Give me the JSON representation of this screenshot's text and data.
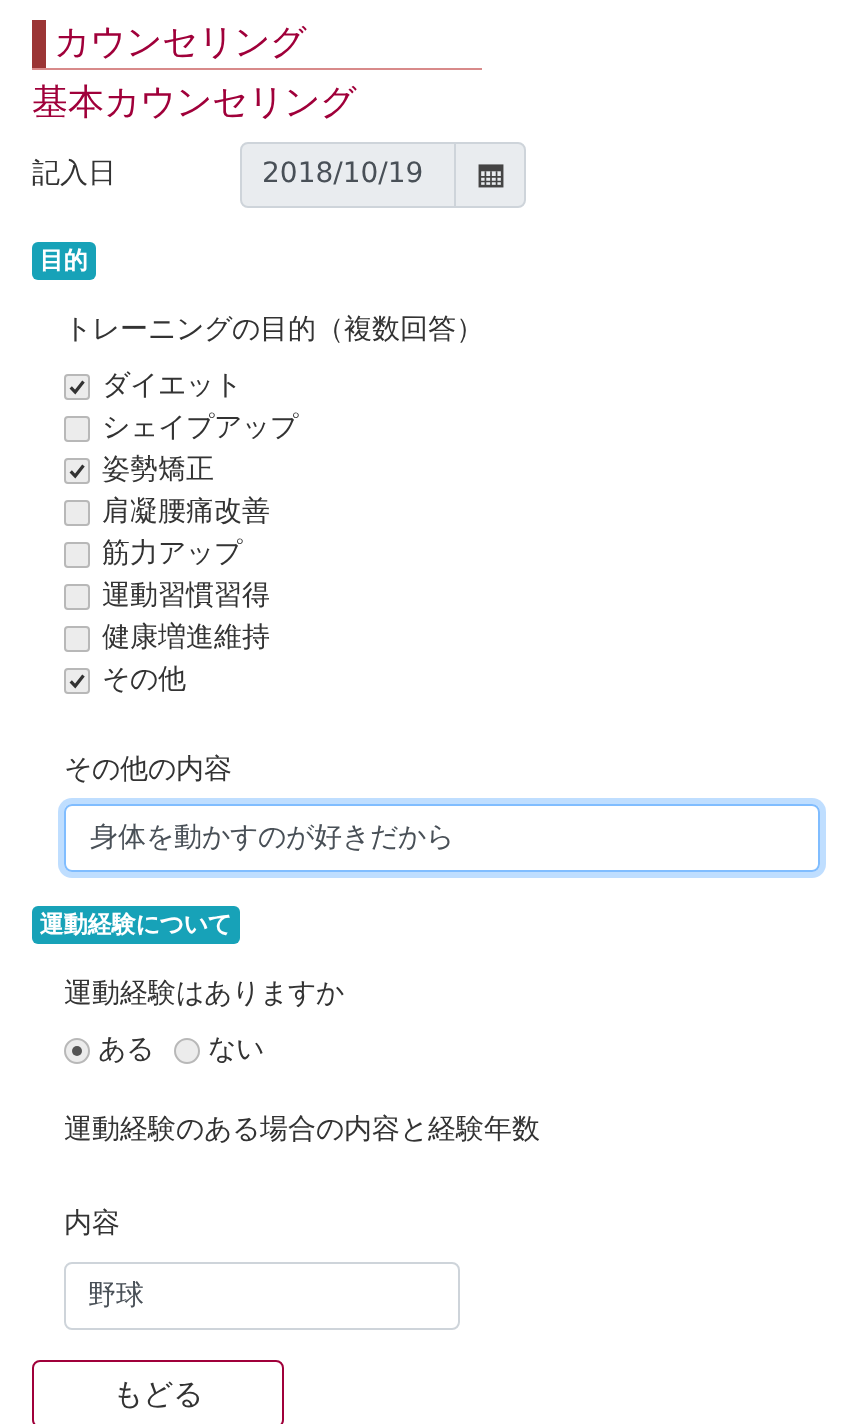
{
  "header": {
    "title": "カウンセリング",
    "subtitle": "基本カウンセリング"
  },
  "entry_date": {
    "label": "記入日",
    "value": "2018/10/19"
  },
  "purpose": {
    "badge": "目的",
    "question": "トレーニングの目的（複数回答）",
    "options": [
      {
        "label": "ダイエット",
        "checked": true
      },
      {
        "label": "シェイプアップ",
        "checked": false
      },
      {
        "label": "姿勢矯正",
        "checked": true
      },
      {
        "label": "肩凝腰痛改善",
        "checked": false
      },
      {
        "label": "筋力アップ",
        "checked": false
      },
      {
        "label": "運動習慣習得",
        "checked": false
      },
      {
        "label": "健康増進維持",
        "checked": false
      },
      {
        "label": "その他",
        "checked": true
      }
    ],
    "other_label": "その他の内容",
    "other_value": "身体を動かすのが好きだから",
    "other_focused": true
  },
  "experience": {
    "badge": "運動経験について",
    "question": "運動経験はありますか",
    "choices": [
      {
        "label": "ある",
        "selected": true
      },
      {
        "label": "ない",
        "selected": false
      }
    ],
    "detail_heading": "運動経験のある場合の内容と経験年数",
    "content_label": "内容",
    "content_value": "野球"
  },
  "back_button": "もどる"
}
